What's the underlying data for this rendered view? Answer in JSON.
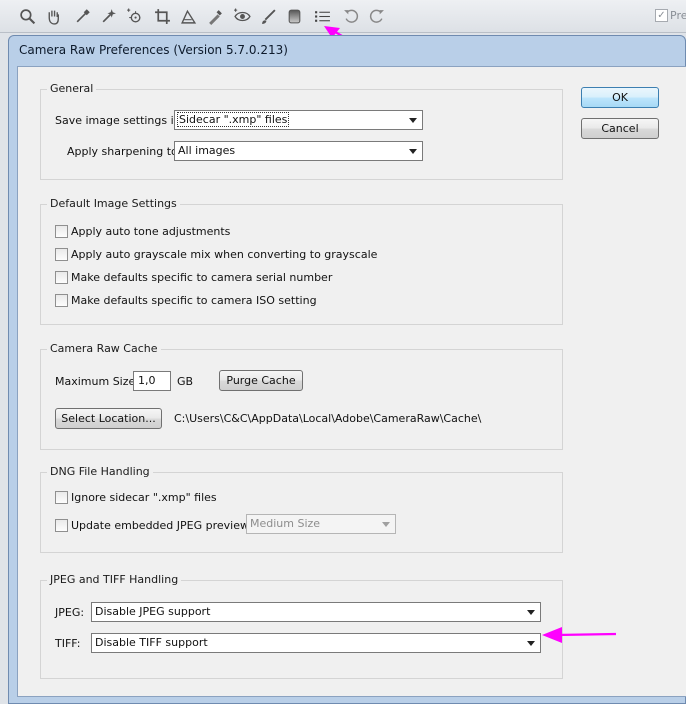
{
  "toolbar": {
    "tools": [
      {
        "icon": "zoom-icon"
      },
      {
        "icon": "hand-icon"
      },
      {
        "icon": "white-balance-icon"
      },
      {
        "icon": "color-sampler-icon"
      },
      {
        "icon": "target-adjustment-icon"
      },
      {
        "icon": "crop-icon"
      },
      {
        "icon": "straighten-icon"
      },
      {
        "icon": "spot-removal-icon"
      },
      {
        "icon": "red-eye-icon"
      },
      {
        "icon": "adjustment-brush-icon"
      },
      {
        "icon": "graduated-filter-icon"
      },
      {
        "icon": "preferences-icon"
      },
      {
        "icon": "rotate-left-icon"
      },
      {
        "icon": "rotate-right-icon"
      }
    ],
    "preview_label": "Pre",
    "preview_checked": "✓"
  },
  "dialog": {
    "title": "Camera Raw Preferences  (Version 5.7.0.213)",
    "ok_label": "OK",
    "cancel_label": "Cancel"
  },
  "general": {
    "title": "General",
    "save_label": "Save image settings in:",
    "save_value": "Sidecar \".xmp\" files",
    "sharpen_label": "Apply sharpening to:",
    "sharpen_value": "All images"
  },
  "defaults": {
    "title": "Default Image Settings",
    "options": [
      "Apply auto tone adjustments",
      "Apply auto grayscale mix when converting to grayscale",
      "Make defaults specific to camera serial number",
      "Make defaults specific to camera ISO setting"
    ]
  },
  "cache": {
    "title": "Camera Raw Cache",
    "max_size_label": "Maximum Size:",
    "max_size_value": "1,0",
    "unit": "GB",
    "purge_label": "Purge Cache",
    "select_location_label": "Select Location...",
    "path": "C:\\Users\\C&C\\AppData\\Local\\Adobe\\CameraRaw\\Cache\\"
  },
  "dng": {
    "title": "DNG File Handling",
    "ignore_label": "Ignore sidecar \".xmp\" files",
    "update_label": "Update embedded JPEG previews:",
    "preview_size_value": "Medium Size"
  },
  "jpeg_tiff": {
    "title": "JPEG and TIFF Handling",
    "jpeg_label": "JPEG:",
    "jpeg_value": "Disable JPEG support",
    "tiff_label": "TIFF:",
    "tiff_value": "Disable TIFF support"
  },
  "colors": {
    "annotation_arrow": "#ff00ff",
    "dialog_frame": "#b9cfe8",
    "default_button_border": "#3c7fb1"
  }
}
